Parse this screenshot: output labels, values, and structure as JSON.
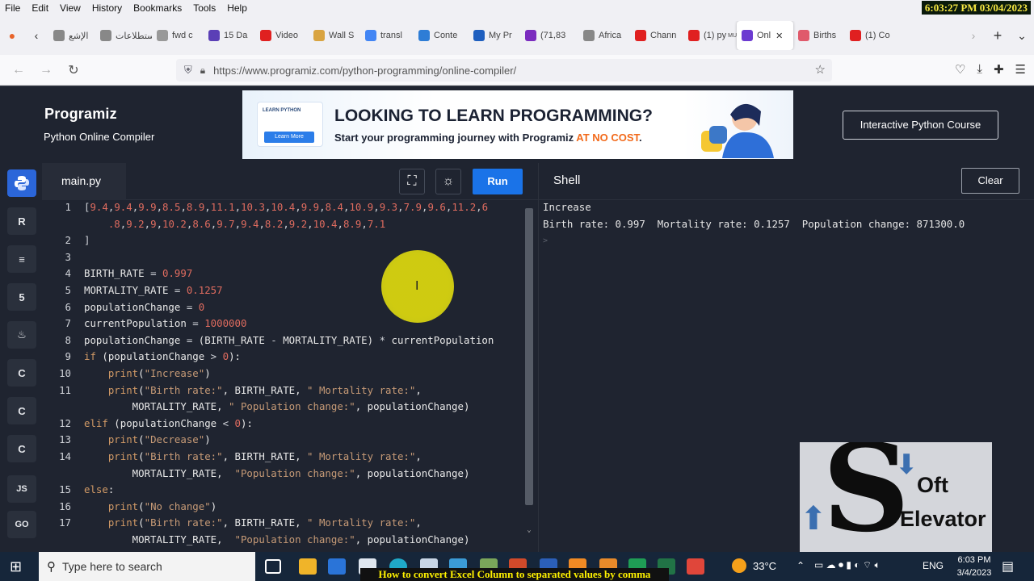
{
  "menubar": {
    "items": [
      "File",
      "Edit",
      "View",
      "History",
      "Bookmarks",
      "Tools",
      "Help"
    ],
    "clock": "6:03:27 PM 03/04/2023"
  },
  "tabs": [
    {
      "label": "الإشع",
      "color": "#888888"
    },
    {
      "label": "استطلاعات",
      "color": "#888888"
    },
    {
      "label": "fwd c",
      "color": "#999999"
    },
    {
      "label": "15 Da",
      "color": "#5b3fb6"
    },
    {
      "label": "Video",
      "color": "#e02020"
    },
    {
      "label": "Wall S",
      "color": "#d9a441"
    },
    {
      "label": "transl",
      "color": "#4285f4"
    },
    {
      "label": "Conte",
      "color": "#2e7dd6"
    },
    {
      "label": "My Pr",
      "color": "#1f5fbf"
    },
    {
      "label": "(71,83",
      "color": "#7b2cbf"
    },
    {
      "label": "Africa",
      "color": "#888888"
    },
    {
      "label": "Chann",
      "color": "#e02020"
    },
    {
      "label": "(1) py",
      "sub": "MUTED",
      "color": "#e02020"
    },
    {
      "label": "Onl",
      "color": "#6c3bd1",
      "active": true
    },
    {
      "label": "Births",
      "color": "#e05a6b"
    },
    {
      "label": "(1) Co",
      "color": "#e02020"
    }
  ],
  "nav": {
    "url": "https://www.programiz.com/python-programming/online-compiler/"
  },
  "header": {
    "logo": "Programiz",
    "subtitle": "Python Online Compiler",
    "banner": {
      "learn_label": "LEARN PYTHON",
      "learn_more": "Learn More",
      "title": "LOOKING TO LEARN PROGRAMMING?",
      "sub_prefix": "Start your programming journey with Programiz ",
      "sub_accent": "AT NO COST",
      "sub_suffix": "."
    },
    "course_button": "Interactive Python Course"
  },
  "rail": {
    "items": [
      "python-icon",
      "r-icon",
      "sql-icon",
      "html5-icon",
      "java-icon",
      "c-icon",
      "cpp-icon",
      "csharp-icon",
      "JS",
      "GO"
    ]
  },
  "editor": {
    "filename": "main.py",
    "run_label": "Run",
    "lines": [
      {
        "n": "1",
        "html": "<span class='p'>[</span><span class='num'>9.4</span><span class='p'>,</span><span class='num'>9.4</span><span class='p'>,</span><span class='num'>9.9</span><span class='p'>,</span><span class='num'>8.5</span><span class='p'>,</span><span class='num'>8.9</span><span class='p'>,</span><span class='num'>11.1</span><span class='p'>,</span><span class='num'>10.3</span><span class='p'>,</span><span class='num'>10.4</span><span class='p'>,</span><span class='num'>9.9</span><span class='p'>,</span><span class='num'>8.4</span><span class='p'>,</span><span class='num'>10.9</span><span class='p'>,</span><span class='num'>9.3</span><span class='p'>,</span><span class='num'>7.9</span><span class='p'>,</span><span class='num'>9.6</span><span class='p'>,</span><span class='num'>11.2</span><span class='p'>,</span><span class='num'>6</span>"
      },
      {
        "n": "",
        "html": "    <span class='num'>.8</span><span class='p'>,</span><span class='num'>9.2</span><span class='p'>,</span><span class='num'>9</span><span class='p'>,</span><span class='num'>10.2</span><span class='p'>,</span><span class='num'>8.6</span><span class='p'>,</span><span class='num'>9.7</span><span class='p'>,</span><span class='num'>9.4</span><span class='p'>,</span><span class='num'>8.2</span><span class='p'>,</span><span class='num'>9.2</span><span class='p'>,</span><span class='num'>10.4</span><span class='p'>,</span><span class='num'>8.9</span><span class='p'>,</span><span class='num'>7.1</span>"
      },
      {
        "n": "2",
        "html": "<span class='p'>]</span>"
      },
      {
        "n": "3",
        "html": ""
      },
      {
        "n": "4",
        "html": "BIRTH_RATE <span class='p'>=</span> <span class='num'>0.997</span>"
      },
      {
        "n": "5",
        "html": "MORTALITY_RATE <span class='p'>=</span> <span class='num'>0.1257</span>"
      },
      {
        "n": "6",
        "html": "populationChange <span class='p'>=</span> <span class='num'>0</span>"
      },
      {
        "n": "7",
        "html": "currentPopulation <span class='p'>=</span> <span class='num'>1000000</span>"
      },
      {
        "n": "8",
        "html": "populationChange <span class='p'>=</span> (BIRTH_RATE <span class='p'>-</span> MORTALITY_RATE) <span class='p'>*</span> currentPopulation"
      },
      {
        "n": "9",
        "html": "<span class='k'>if</span> (populationChange <span class='p'>&gt;</span> <span class='num'>0</span>):"
      },
      {
        "n": "10",
        "html": "    <span class='k'>print</span>(<span class='s'>\"Increase\"</span>)"
      },
      {
        "n": "11",
        "html": "    <span class='k'>print</span>(<span class='s'>\"Birth rate:\"</span>, BIRTH_RATE, <span class='s'>\" Mortality rate:\"</span>,"
      },
      {
        "n": "",
        "html": "        MORTALITY_RATE, <span class='s'>\" Population change:\"</span>, populationChange)"
      },
      {
        "n": "12",
        "html": "<span class='k'>elif</span> (populationChange <span class='p'>&lt;</span> <span class='num'>0</span>):"
      },
      {
        "n": "13",
        "html": "    <span class='k'>print</span>(<span class='s'>\"Decrease\"</span>)"
      },
      {
        "n": "14",
        "html": "    <span class='k'>print</span>(<span class='s'>\"Birth rate:\"</span>, BIRTH_RATE, <span class='s'>\" Mortality rate:\"</span>,"
      },
      {
        "n": "",
        "html": "        MORTALITY_RATE,  <span class='s'>\"Population change:\"</span>, populationChange)"
      },
      {
        "n": "15",
        "html": "<span class='k'>else</span>:"
      },
      {
        "n": "16",
        "html": "    <span class='k'>print</span>(<span class='s'>\"No change\"</span>)"
      },
      {
        "n": "17",
        "html": "    <span class='k'>print</span>(<span class='s'>\"Birth rate:\"</span>, BIRTH_RATE, <span class='s'>\" Mortality rate:\"</span>,"
      },
      {
        "n": "",
        "html": "        MORTALITY_RATE,  <span class='s'>\"Population change:\"</span>, populationChange)"
      }
    ]
  },
  "shell": {
    "title": "Shell",
    "clear_label": "Clear",
    "output": [
      "Increase",
      "Birth rate: 0.997  Mortality rate: 0.1257  Population change: 871300.0"
    ],
    "prompt": ">"
  },
  "watermark": {
    "letter": "S",
    "line1": "Oft",
    "line2": "Elevator"
  },
  "taskbar": {
    "search_placeholder": "Type here to search",
    "weather": "33°C",
    "lang": "ENG",
    "time": "6:03 PM",
    "date": "3/4/2023",
    "caption": "How to convert Excel Column to  separated values by comma"
  }
}
